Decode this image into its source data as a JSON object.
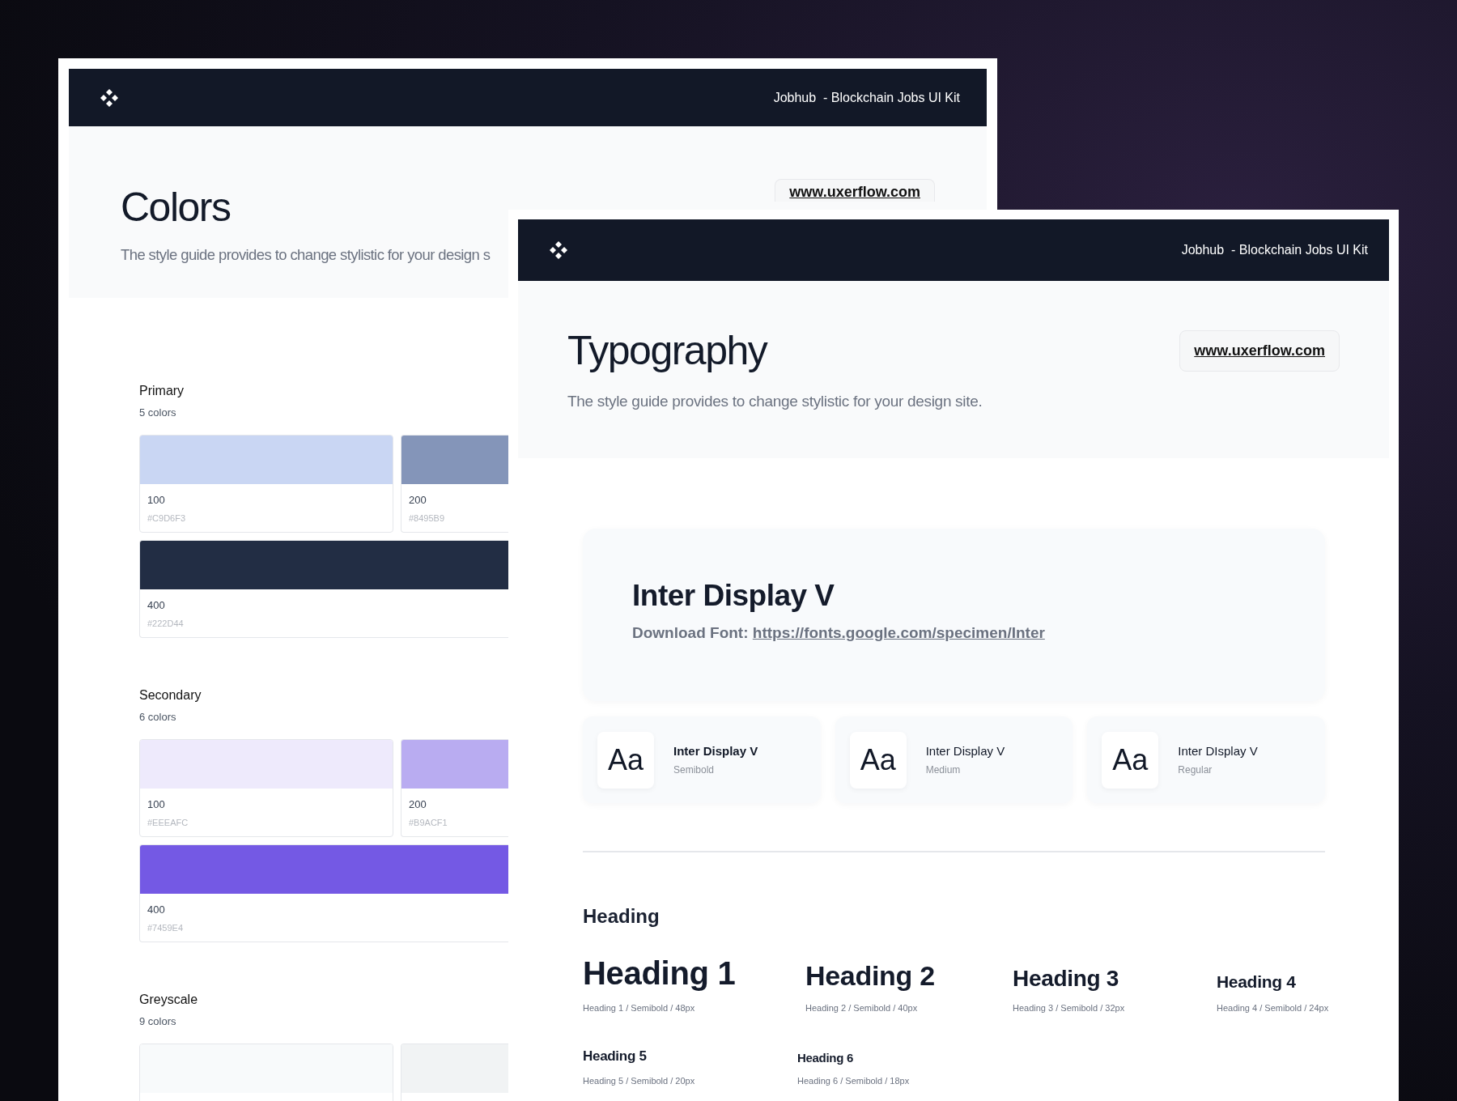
{
  "colors_page": {
    "header_title": "Jobhub  - Blockchain Jobs UI Kit",
    "title": "Colors",
    "subtitle": "The style guide provides to change stylistic for your design s",
    "link": "www.uxerflow.com",
    "palettes": [
      {
        "name": "Primary",
        "count": "5 colors",
        "rows": [
          [
            {
              "label": "100",
              "hex": "#C9D6F3",
              "color": "#c9d6f3"
            },
            {
              "label": "200",
              "hex": "#8495B9",
              "color": "#8495b9"
            }
          ],
          [
            {
              "label": "400",
              "hex": "#222D44",
              "color": "#222d44"
            }
          ]
        ]
      },
      {
        "name": "Secondary",
        "count": "6 colors",
        "rows": [
          [
            {
              "label": "100",
              "hex": "#EEEAFC",
              "color": "#eeeafc"
            },
            {
              "label": "200",
              "hex": "#B9ACF1",
              "color": "#b9acf1"
            }
          ],
          [
            {
              "label": "400",
              "hex": "#7459E4",
              "color": "#7459e4"
            }
          ]
        ]
      },
      {
        "name": "Greyscale",
        "count": "9 colors",
        "rows": [
          [
            {
              "color": "#f8fafb"
            },
            {
              "color": "#f1f3f4"
            }
          ]
        ]
      }
    ]
  },
  "typography_page": {
    "header_title": "Jobhub  - Blockchain Jobs UI Kit",
    "title": "Typography",
    "subtitle": "The style guide provides to change stylistic for your design site.",
    "link": "www.uxerflow.com",
    "font": {
      "name": "Inter Display V",
      "download_label": "Download Font:",
      "download_url": "https://fonts.google.com/specimen/Inter"
    },
    "weights": [
      {
        "sample": "Aa",
        "name": "Inter Display V",
        "weight": "Semibold",
        "kind": "semibold"
      },
      {
        "sample": "Aa",
        "name": "Inter Display V",
        "weight": "Medium",
        "kind": "medium"
      },
      {
        "sample": "Aa",
        "name": "Inter DIsplay V",
        "weight": "Regular",
        "kind": "regular"
      }
    ],
    "heading_section": "Heading",
    "headings": [
      {
        "text": "Heading 1",
        "caption": "Heading 1 / Semibold / 48px",
        "kind": "h1"
      },
      {
        "text": "Heading 2",
        "caption": "Heading 2 / Semibold / 40px",
        "kind": "h2"
      },
      {
        "text": "Heading 3",
        "caption": "Heading 3 / Semibold / 32px",
        "kind": "h3"
      },
      {
        "text": "Heading 4",
        "caption": "Heading 4 / Semibold / 24px",
        "kind": "h4"
      },
      {
        "text": "Heading 5",
        "caption": "Heading 5 / Semibold / 20px",
        "kind": "h5"
      },
      {
        "text": "Heading 6",
        "caption": "Heading 6 / Semibold / 18px",
        "kind": "h6"
      }
    ]
  }
}
